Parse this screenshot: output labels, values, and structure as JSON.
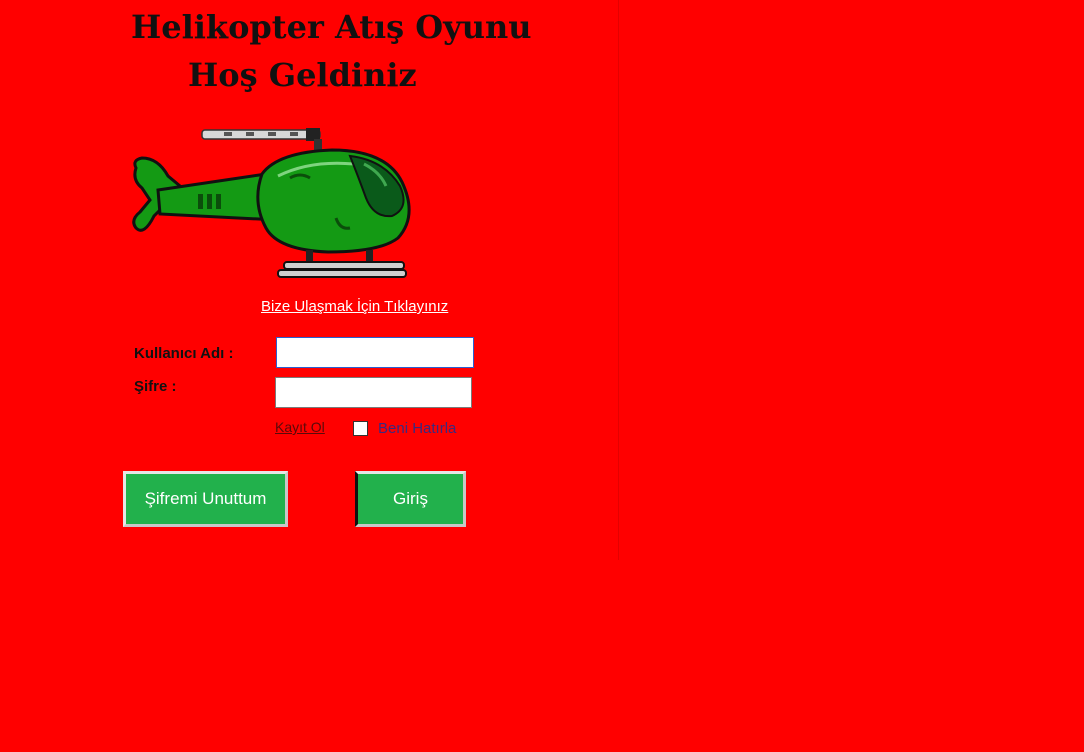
{
  "header": {
    "title": "Helikopter Atış Oyunu",
    "subtitle": "Hoş Geldiniz"
  },
  "contact_link": "Bize Ulaşmak İçin Tıklayınız",
  "form": {
    "username_label": "Kullanıcı Adı :",
    "username_value": "",
    "password_label": "Şifre :",
    "password_value": "",
    "register_link": "Kayıt Ol",
    "remember_label": "Beni Hatırla",
    "remember_checked": false
  },
  "buttons": {
    "forgot_password": "Şifremi Unuttum",
    "login": "Giriş"
  },
  "colors": {
    "background": "#ff0000",
    "button": "#22b14c",
    "helicopter_body": "#149a14"
  },
  "icons": {
    "helicopter": "helicopter-image"
  }
}
